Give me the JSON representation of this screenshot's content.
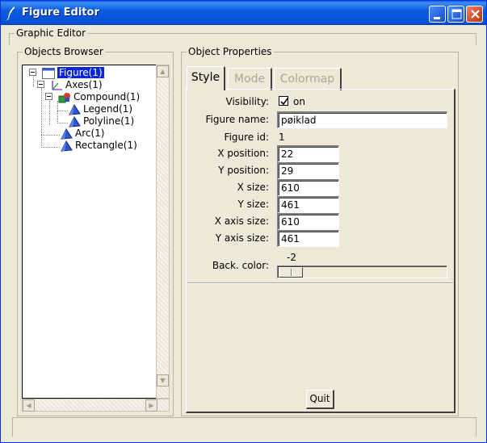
{
  "window": {
    "title": "Figure Editor"
  },
  "graphic_editor": {
    "title": "Graphic Editor"
  },
  "browser": {
    "title": "Objects Browser",
    "tree": [
      {
        "label": "Figure(1)",
        "icon": "figure-window-icon",
        "selected": true
      },
      {
        "label": "Axes(1)",
        "icon": "axes-icon"
      },
      {
        "label": "Compound(1)",
        "icon": "compound-icon"
      },
      {
        "label": "Legend(1)",
        "icon": "polygon-icon"
      },
      {
        "label": "Polyline(1)",
        "icon": "polygon-icon"
      },
      {
        "label": "Arc(1)",
        "icon": "polygon-icon"
      },
      {
        "label": "Rectangle(1)",
        "icon": "polygon-icon"
      }
    ]
  },
  "properties": {
    "title": "Object Properties",
    "tabs": [
      {
        "label": "Style",
        "active": true
      },
      {
        "label": "Mode",
        "active": false
      },
      {
        "label": "Colormap",
        "active": false
      }
    ],
    "visibility": {
      "label": "Visibility:",
      "checked": true,
      "text": "on"
    },
    "figure_name": {
      "label": "Figure name:",
      "value": "pøiklad"
    },
    "figure_id": {
      "label": "Figure id:",
      "value": "1"
    },
    "x_position": {
      "label": "X position:",
      "value": "22"
    },
    "y_position": {
      "label": "Y position:",
      "value": "29"
    },
    "x_size": {
      "label": "X size:",
      "value": "610"
    },
    "y_size": {
      "label": "Y size:",
      "value": "461"
    },
    "x_axis_size": {
      "label": "X axis size:",
      "value": "610"
    },
    "y_axis_size": {
      "label": "Y axis size:",
      "value": "461"
    },
    "back_color": {
      "label": "Back. color:",
      "value": "-2"
    },
    "quit_label": "Quit"
  },
  "colors": {
    "titlebar": "#0a5ae0",
    "face": "#ece9d8",
    "selection": "#0a24e0"
  }
}
